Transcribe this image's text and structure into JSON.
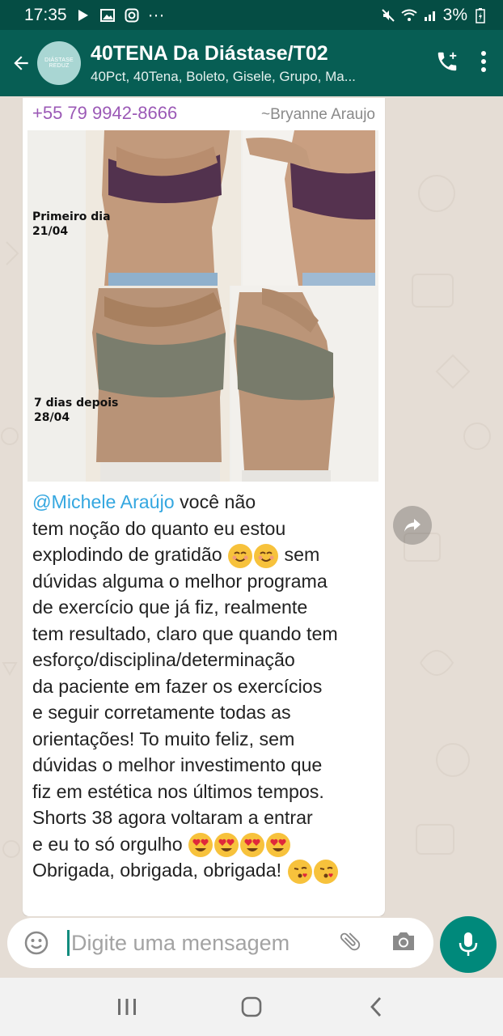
{
  "status_bar": {
    "time": "17:35",
    "more": "···",
    "battery": "3%"
  },
  "header": {
    "avatar_text": "DIÁSTASE REDUZ",
    "title": "40TENA Da Diástase/T02",
    "subtitle": "40Pct, 40Tena, Boleto, Gisele, Grupo, Ma..."
  },
  "message": {
    "sender_phone": "+55 79 9942-8666",
    "sender_alias": "~Bryanne Araujo",
    "photo": {
      "caption_top": [
        "Primeiro dia",
        "21/04"
      ],
      "caption_bottom": [
        "7 dias depois",
        "28/04"
      ]
    },
    "mention": "@Michele Araújo",
    "lines": [
      " você não",
      "tem noção do quanto eu estou",
      "explodindo de gratidão",
      " sem",
      "dúvidas alguma o melhor programa",
      "de exercício que já fiz, realmente",
      "tem resultado, claro que quando tem",
      "esforço/disciplina/determinação",
      "da paciente em fazer os exercícios",
      "e seguir corretamente todas as",
      "orientações! To muito feliz, sem",
      "dúvidas o melhor investimento que",
      "fiz em estética nos últimos tempos.",
      "Shorts 38 agora voltaram a entrar",
      "e eu to só orgulho",
      "Obrigada, obrigada, obrigada!"
    ]
  },
  "input": {
    "placeholder": "Digite uma mensagem"
  },
  "colors": {
    "header": "#075e54",
    "status_bar": "#054d44",
    "accent": "#00897b",
    "phone_color": "#9b59b6",
    "mention_color": "#34a7e0"
  },
  "icons": {
    "back": "arrow-left-icon",
    "add_call": "phone-plus-icon",
    "menu": "more-vertical-icon",
    "forward": "forward-icon",
    "emoji": "smiley-icon",
    "attach": "paperclip-icon",
    "camera": "camera-icon",
    "mic": "microphone-icon"
  }
}
